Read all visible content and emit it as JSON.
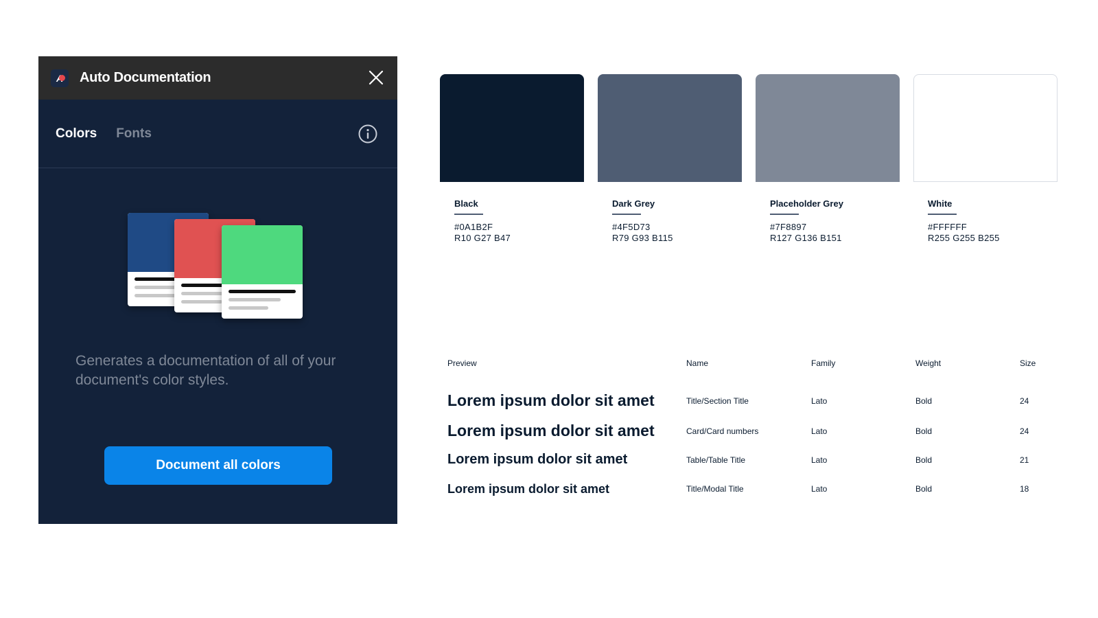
{
  "panel": {
    "title": "Auto Documentation",
    "logo_letter": "A",
    "tabs": [
      {
        "label": "Colors",
        "active": true
      },
      {
        "label": "Fonts",
        "active": false
      }
    ],
    "description": "Generates a documentation of all of your document's color styles.",
    "cta_label": "Document all colors",
    "illustration_colors": [
      "#1F4A85",
      "#E05252",
      "#4ED97E"
    ]
  },
  "colors": [
    {
      "name": "Black",
      "hex": "#0A1B2F",
      "rgb": "R10 G27 B47",
      "color": "#0A1B2F"
    },
    {
      "name": "Dark Grey",
      "hex": "#4F5D73",
      "rgb": "R79 G93 B115",
      "color": "#4F5D73"
    },
    {
      "name": "Placeholder Grey",
      "hex": "#7F8897",
      "rgb": "R127 G136 B151",
      "color": "#7F8897"
    },
    {
      "name": "White",
      "hex": "#FFFFFF",
      "rgb": "R255 G255 B255",
      "color": "#FFFFFF"
    }
  ],
  "fonts_table": {
    "headers": {
      "preview": "Preview",
      "name": "Name",
      "family": "Family",
      "weight": "Weight",
      "size": "Size"
    },
    "rows": [
      {
        "preview": "Lorem ipsum dolor sit amet",
        "name": "Title/Section Title",
        "family": "Lato",
        "weight": "Bold",
        "size": "24"
      },
      {
        "preview": "Lorem ipsum dolor sit amet",
        "name": "Card/Card numbers",
        "family": "Lato",
        "weight": "Bold",
        "size": "24"
      },
      {
        "preview": "Lorem ipsum dolor sit amet",
        "name": "Table/Table Title",
        "family": "Lato",
        "weight": "Bold",
        "size": "21"
      },
      {
        "preview": "Lorem ipsum dolor sit amet",
        "name": "Title/Modal Title",
        "family": "Lato",
        "weight": "Bold",
        "size": "18"
      }
    ]
  },
  "accent": "#0A84E8"
}
